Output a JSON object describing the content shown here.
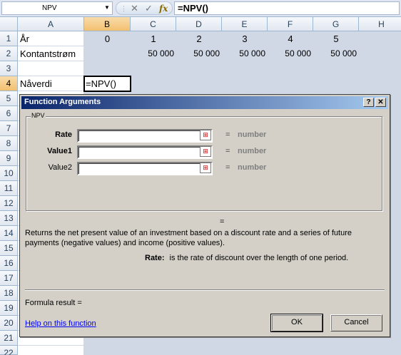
{
  "formula_bar": {
    "name_box": "NPV",
    "name_box_arrow": "▼",
    "cancel_icon": "✕",
    "enter_icon": "✓",
    "fx_label": "fx",
    "formula": "=NPV()"
  },
  "grid": {
    "columns": [
      "A",
      "B",
      "C",
      "D",
      "E",
      "F",
      "G",
      "H"
    ],
    "rows": [
      "1",
      "2",
      "3",
      "4",
      "5",
      "6",
      "7",
      "8",
      "9",
      "10",
      "11",
      "12",
      "13",
      "14",
      "15",
      "16",
      "17",
      "18",
      "19",
      "20",
      "21",
      "22"
    ],
    "cells": {
      "a1": "År",
      "b1": "0",
      "c1": "1",
      "d1": "2",
      "e1": "3",
      "f1": "4",
      "g1": "5",
      "a2": "Kontantstrøm",
      "c2": "50 000",
      "d2": "50 000",
      "e2": "50 000",
      "f2": "50 000",
      "g2": "50 000",
      "a4": "Nåverdi",
      "b4": "=NPV()"
    }
  },
  "dialog": {
    "title": "Function Arguments",
    "help_button": "?",
    "close_button": "✕",
    "group_label": "NPV",
    "arguments": [
      {
        "label": "Rate",
        "value": "",
        "equals": "=",
        "type_hint": "number"
      },
      {
        "label": "Value1",
        "value": "",
        "equals": "=",
        "type_hint": "number"
      },
      {
        "label": "Value2",
        "value": "",
        "equals": "=",
        "type_hint": "number"
      }
    ],
    "collapse_icon": "⊞",
    "result_equals": "=",
    "description": "Returns the net present value of an investment based on a discount rate and a series of future payments (negative values) and income (positive values).",
    "arg_help_name": "Rate:",
    "arg_help_text": "is the rate of discount over the length of one period.",
    "formula_result_label": "Formula result =",
    "help_link": "Help on this function",
    "ok_label": "OK",
    "cancel_label": "Cancel"
  }
}
